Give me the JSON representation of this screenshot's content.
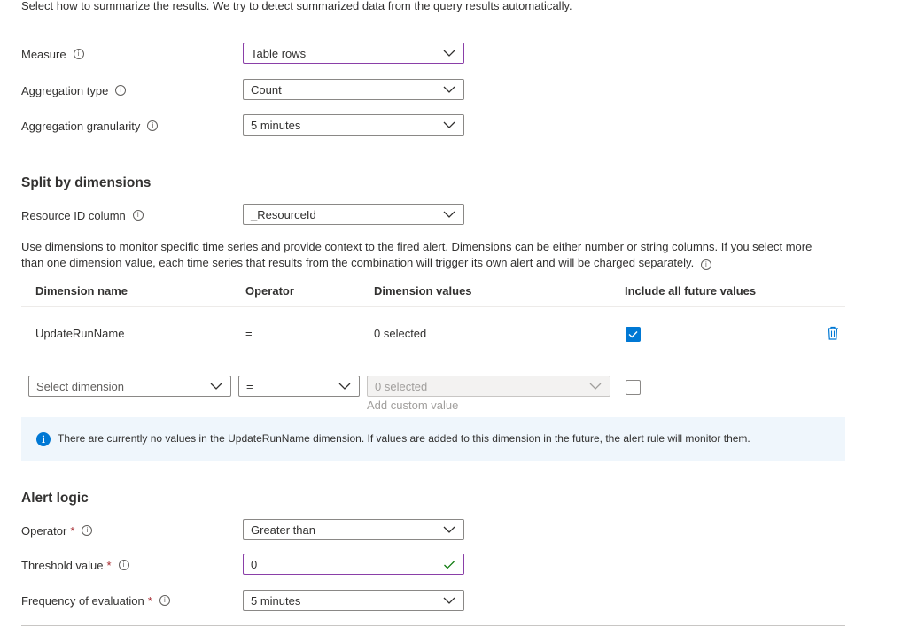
{
  "intro_text": "Select how to summarize the results. We try to detect summarized data from the query results automatically.",
  "measurement": {
    "measure": {
      "label": "Measure",
      "value": "Table rows"
    },
    "aggregation_type": {
      "label": "Aggregation type",
      "value": "Count"
    },
    "aggregation_granularity": {
      "label": "Aggregation granularity",
      "value": "5 minutes"
    }
  },
  "split": {
    "heading": "Split by dimensions",
    "resource_id": {
      "label": "Resource ID column",
      "value": "_ResourceId"
    },
    "description": "Use dimensions to monitor specific time series and provide context to the fired alert. Dimensions can be either number or string columns. If you select more than one dimension value, each time series that results from the combination will trigger its own alert and will be charged separately.",
    "columns": [
      "Dimension name",
      "Operator",
      "Dimension values",
      "Include all future values"
    ],
    "row": {
      "name": "UpdateRunName",
      "operator": "=",
      "values": "0 selected",
      "include_future": true
    },
    "new_row": {
      "dimension_placeholder": "Select dimension",
      "operator": "=",
      "values": "0 selected",
      "add_custom": "Add custom value"
    },
    "info_message": "There are currently no values in the UpdateRunName dimension. If values are added to this dimension in the future, the alert rule will monitor them."
  },
  "alert_logic": {
    "heading": "Alert logic",
    "operator": {
      "label": "Operator",
      "value": "Greater than"
    },
    "threshold": {
      "label": "Threshold value",
      "value": "0"
    },
    "frequency": {
      "label": "Frequency of evaluation",
      "value": "5 minutes"
    },
    "required_mark": "*"
  },
  "colors": {
    "accent": "#0078d4",
    "focus_border": "#8a3fa8",
    "valid_check": "#107c10",
    "info_bg": "#eff6fc"
  }
}
